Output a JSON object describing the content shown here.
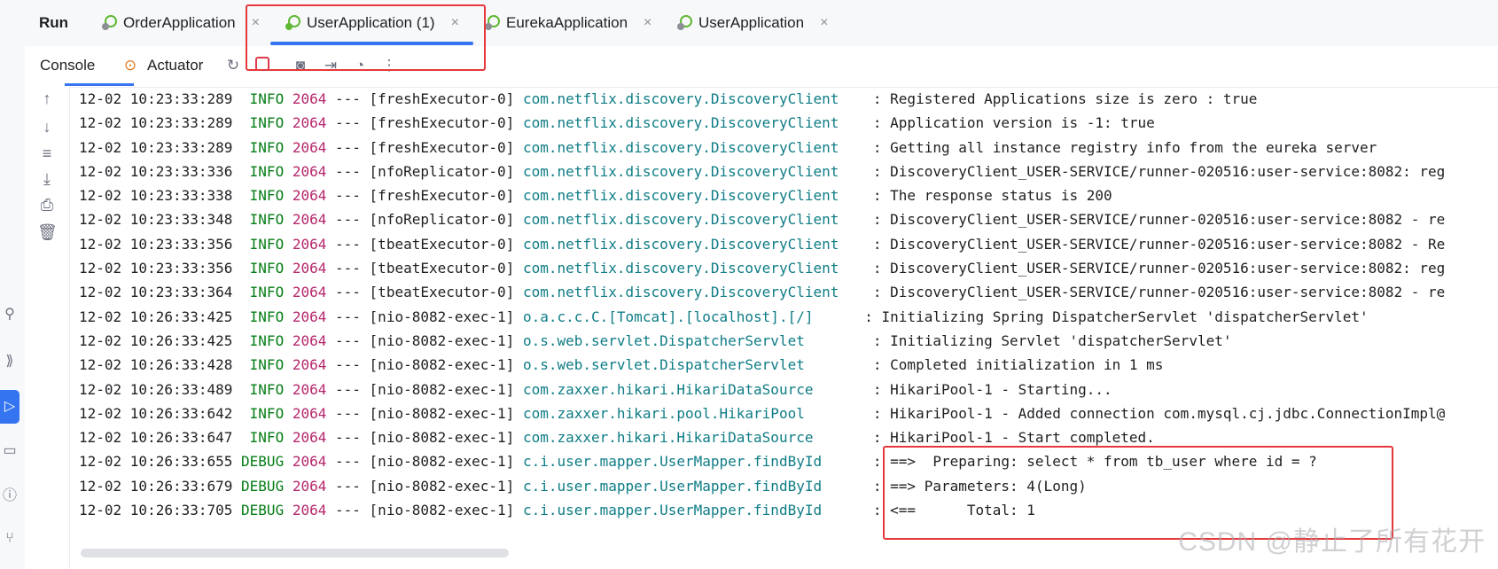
{
  "run_label": "Run",
  "tabs": [
    {
      "label": "OrderApplication",
      "icon": "spring-boot-app-icon"
    },
    {
      "label": "UserApplication (1)",
      "icon": "spring-boot-app-icon"
    },
    {
      "label": "EurekaApplication",
      "icon": "spring-boot-app-icon"
    },
    {
      "label": "UserApplication",
      "icon": "spring-boot-app-icon"
    }
  ],
  "close_glyph": "×",
  "toolbar": {
    "console_label": "Console",
    "actuator_label": "Actuator"
  },
  "log_lines": [
    {
      "ts": "12-02 10:23:33:289",
      "level": " INFO",
      "pid": "2064",
      "thread": "--- [freshExecutor-0]",
      "logger": "com.netflix.discovery.DiscoveryClient   ",
      "msg": " : Registered Applications size is zero : true"
    },
    {
      "ts": "12-02 10:23:33:289",
      "level": " INFO",
      "pid": "2064",
      "thread": "--- [freshExecutor-0]",
      "logger": "com.netflix.discovery.DiscoveryClient   ",
      "msg": " : Application version is -1: true"
    },
    {
      "ts": "12-02 10:23:33:289",
      "level": " INFO",
      "pid": "2064",
      "thread": "--- [freshExecutor-0]",
      "logger": "com.netflix.discovery.DiscoveryClient   ",
      "msg": " : Getting all instance registry info from the eureka server"
    },
    {
      "ts": "12-02 10:23:33:336",
      "level": " INFO",
      "pid": "2064",
      "thread": "--- [nfoReplicator-0]",
      "logger": "com.netflix.discovery.DiscoveryClient   ",
      "msg": " : DiscoveryClient_USER-SERVICE/runner-020516:user-service:8082: reg"
    },
    {
      "ts": "12-02 10:23:33:338",
      "level": " INFO",
      "pid": "2064",
      "thread": "--- [freshExecutor-0]",
      "logger": "com.netflix.discovery.DiscoveryClient   ",
      "msg": " : The response status is 200"
    },
    {
      "ts": "12-02 10:23:33:348",
      "level": " INFO",
      "pid": "2064",
      "thread": "--- [nfoReplicator-0]",
      "logger": "com.netflix.discovery.DiscoveryClient   ",
      "msg": " : DiscoveryClient_USER-SERVICE/runner-020516:user-service:8082 - re"
    },
    {
      "ts": "12-02 10:23:33:356",
      "level": " INFO",
      "pid": "2064",
      "thread": "--- [tbeatExecutor-0]",
      "logger": "com.netflix.discovery.DiscoveryClient   ",
      "msg": " : DiscoveryClient_USER-SERVICE/runner-020516:user-service:8082 - Re"
    },
    {
      "ts": "12-02 10:23:33:356",
      "level": " INFO",
      "pid": "2064",
      "thread": "--- [tbeatExecutor-0]",
      "logger": "com.netflix.discovery.DiscoveryClient   ",
      "msg": " : DiscoveryClient_USER-SERVICE/runner-020516:user-service:8082: reg"
    },
    {
      "ts": "12-02 10:23:33:364",
      "level": " INFO",
      "pid": "2064",
      "thread": "--- [tbeatExecutor-0]",
      "logger": "com.netflix.discovery.DiscoveryClient   ",
      "msg": " : DiscoveryClient_USER-SERVICE/runner-020516:user-service:8082 - re"
    },
    {
      "ts": "12-02 10:26:33:425",
      "level": " INFO",
      "pid": "2064",
      "thread": "--- [nio-8082-exec-1]",
      "logger": "o.a.c.c.C.[Tomcat].[localhost].[/]     ",
      "msg": " : Initializing Spring DispatcherServlet 'dispatcherServlet'"
    },
    {
      "ts": "12-02 10:26:33:425",
      "level": " INFO",
      "pid": "2064",
      "thread": "--- [nio-8082-exec-1]",
      "logger": "o.s.web.servlet.DispatcherServlet       ",
      "msg": " : Initializing Servlet 'dispatcherServlet'"
    },
    {
      "ts": "12-02 10:26:33:428",
      "level": " INFO",
      "pid": "2064",
      "thread": "--- [nio-8082-exec-1]",
      "logger": "o.s.web.servlet.DispatcherServlet       ",
      "msg": " : Completed initialization in 1 ms"
    },
    {
      "ts": "12-02 10:26:33:489",
      "level": " INFO",
      "pid": "2064",
      "thread": "--- [nio-8082-exec-1]",
      "logger": "com.zaxxer.hikari.HikariDataSource      ",
      "msg": " : HikariPool-1 - Starting..."
    },
    {
      "ts": "12-02 10:26:33:642",
      "level": " INFO",
      "pid": "2064",
      "thread": "--- [nio-8082-exec-1]",
      "logger": "com.zaxxer.hikari.pool.HikariPool       ",
      "msg": " : HikariPool-1 - Added connection com.mysql.cj.jdbc.ConnectionImpl@"
    },
    {
      "ts": "12-02 10:26:33:647",
      "level": " INFO",
      "pid": "2064",
      "thread": "--- [nio-8082-exec-1]",
      "logger": "com.zaxxer.hikari.HikariDataSource      ",
      "msg": " : HikariPool-1 - Start completed."
    },
    {
      "ts": "12-02 10:26:33:655",
      "level": "DEBUG",
      "pid": "2064",
      "thread": "--- [nio-8082-exec-1]",
      "logger": "c.i.user.mapper.UserMapper.findById     ",
      "msg": " : ==>  Preparing: select * from tb_user where id = ?"
    },
    {
      "ts": "12-02 10:26:33:679",
      "level": "DEBUG",
      "pid": "2064",
      "thread": "--- [nio-8082-exec-1]",
      "logger": "c.i.user.mapper.UserMapper.findById     ",
      "msg": " : ==> Parameters: 4(Long)"
    },
    {
      "ts": "12-02 10:26:33:705",
      "level": "DEBUG",
      "pid": "2064",
      "thread": "--- [nio-8082-exec-1]",
      "logger": "c.i.user.mapper.UserMapper.findById     ",
      "msg": " : <==      Total: 1"
    }
  ],
  "watermark": "CSDN @静止了所有花开",
  "colors": {
    "accent": "#3574f0",
    "highlight": "#e5383b",
    "log_level": "#067d17",
    "pid": "#b5266b",
    "logger": "#0e7c86"
  }
}
